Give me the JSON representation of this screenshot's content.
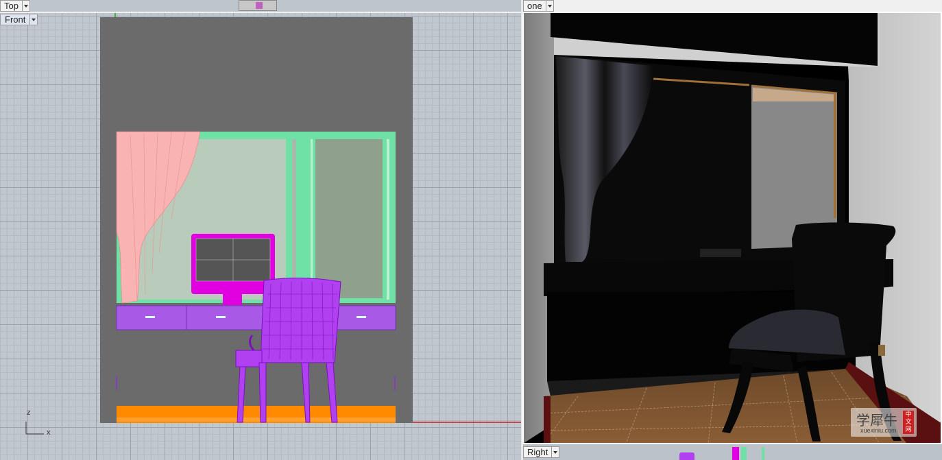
{
  "viewports": {
    "top": {
      "label": "Top"
    },
    "front": {
      "label": "Front",
      "axis_z": "z",
      "axis_x": "x"
    },
    "perspective": {
      "label": "one"
    },
    "right": {
      "label": "Right"
    }
  },
  "watermark": {
    "text": "学犀牛",
    "url": "xuexiniu.com",
    "badge": "中文网"
  },
  "colors": {
    "viewport_bg": "#c1c7cf",
    "wall_panel": "#6b6b6b",
    "window_frame": "#6fe0a6",
    "curtain": "#f9b3b3",
    "monitor": "#e000e0",
    "desk": "#a85ae6",
    "chair": "#b040f0",
    "floor_board": "#ff8a00",
    "axis_red": "#c02020"
  }
}
